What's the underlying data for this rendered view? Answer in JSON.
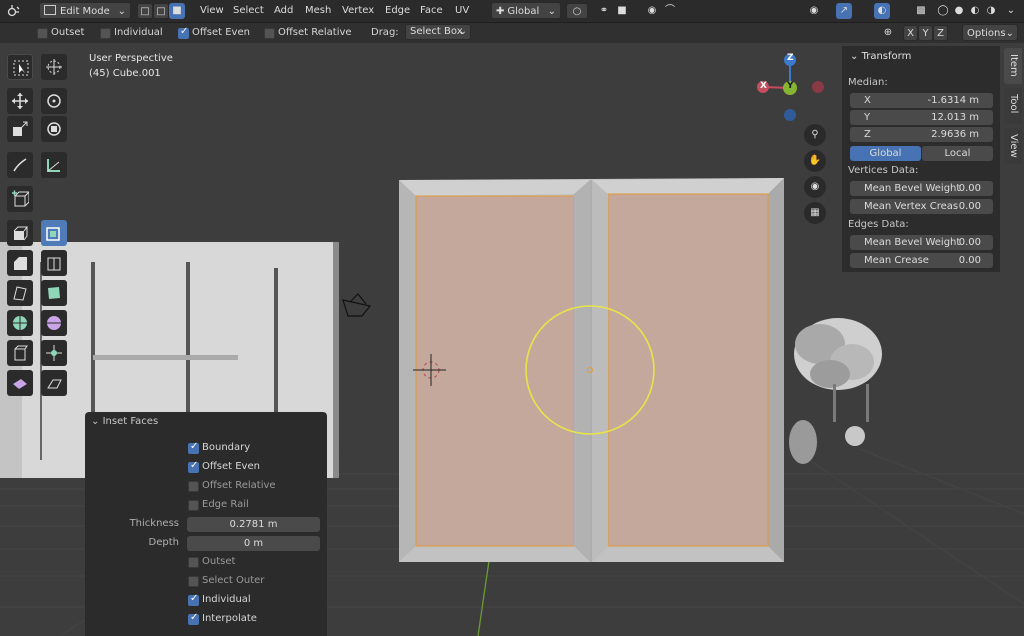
{
  "header": {
    "mode": "Edit Mode",
    "menus": [
      "View",
      "Select",
      "Add",
      "Mesh",
      "Vertex",
      "Edge",
      "Face",
      "UV"
    ],
    "orientation": "Global",
    "axis_x": "X",
    "axis_y": "Y",
    "axis_z": "Z",
    "options": "Options"
  },
  "subbar": {
    "outset": "Outset",
    "individual": "Individual",
    "offset_even": "Offset Even",
    "offset_relative": "Offset Relative",
    "drag_label": "Drag:",
    "drag_value": "Select Box"
  },
  "viewport": {
    "perspective": "User Perspective",
    "object": "(45) Cube.001"
  },
  "gizmo": {
    "x": "X",
    "y": "Y",
    "z": "Z"
  },
  "npanel": {
    "title": "Transform",
    "median": "Median:",
    "x_label": "X",
    "x_value": "-1.6314 m",
    "y_label": "Y",
    "y_value": "12.013 m",
    "z_label": "Z",
    "z_value": "2.9636 m",
    "global": "Global",
    "local": "Local",
    "vertices_data": "Vertices Data:",
    "mean_bevel_weight_v": "Mean Bevel Weight",
    "mean_bevel_weight_v_value": "0.00",
    "mean_vertex_crease": "Mean Vertex Creas",
    "mean_vertex_crease_value": "0.00",
    "edges_data": "Edges Data:",
    "mean_bevel_weight_e": "Mean Bevel Weight",
    "mean_bevel_weight_e_value": "0.00",
    "mean_crease": "Mean Crease",
    "mean_crease_value": "0.00"
  },
  "tabs": {
    "item": "Item",
    "tool": "Tool",
    "view": "View"
  },
  "operator": {
    "title": "Inset Faces",
    "boundary": "Boundary",
    "offset_even": "Offset Even",
    "offset_relative": "Offset Relative",
    "edge_rail": "Edge Rail",
    "thickness_label": "Thickness",
    "thickness_value": "0.2781 m",
    "depth_label": "Depth",
    "depth_value": "0 m",
    "outset": "Outset",
    "select_outer": "Select Outer",
    "individual": "Individual",
    "interpolate": "Interpolate"
  },
  "colors": {
    "accent": "#4772b3",
    "face_select": "#c4a89c",
    "brush_circle": "#e8e34a"
  }
}
